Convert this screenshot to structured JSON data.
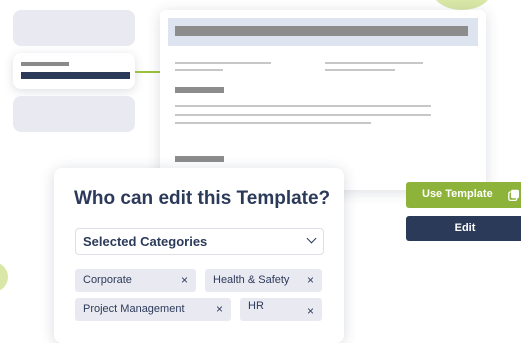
{
  "panel": {
    "title": "Who can edit this Template?",
    "select_value": "Selected Categories"
  },
  "chips": [
    {
      "label": "Corporate"
    },
    {
      "label": "Health & Safety"
    },
    {
      "label": "Project Management"
    },
    {
      "label": "HR"
    }
  ],
  "chip_remove_glyph": "×",
  "buttons": {
    "use_template": "Use Template",
    "edit": "Edit"
  },
  "icons": {
    "copy": "copy-icon",
    "chevron": "chevron-down-icon",
    "remove": "close-icon"
  },
  "colors": {
    "navy": "#2c3a5a",
    "green": "#8db33a",
    "card_gray": "#e9eaf1",
    "highlight_header": "#dde3ef"
  }
}
